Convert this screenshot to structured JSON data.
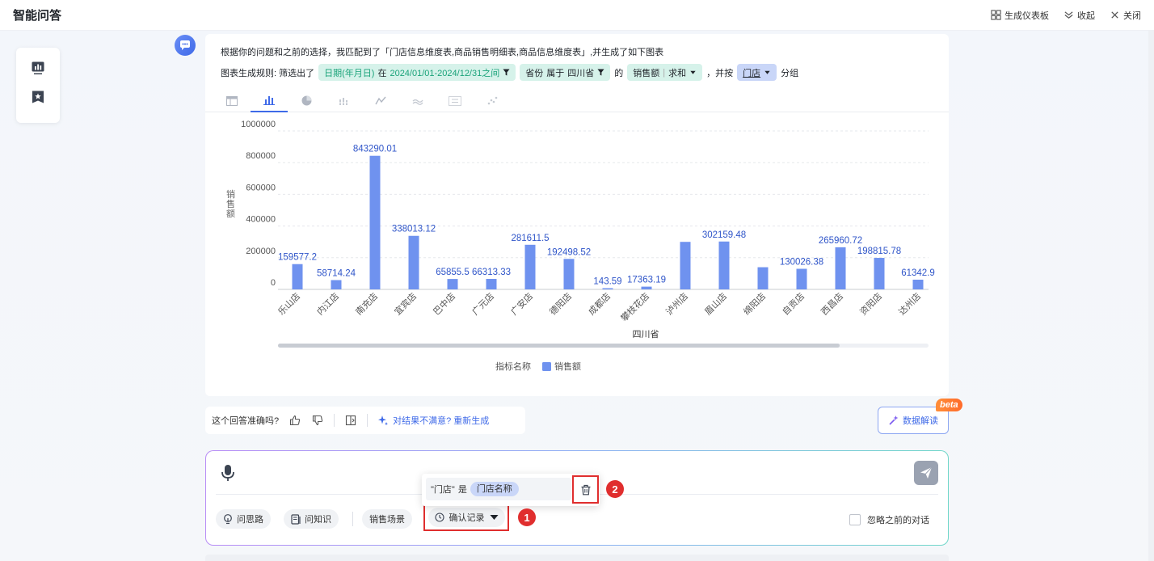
{
  "header": {
    "title": "智能问答",
    "actions": [
      {
        "label": "生成仪表板",
        "icon": "dashboard-grid-icon"
      },
      {
        "label": "收起",
        "icon": "collapse-chevron-icon"
      },
      {
        "label": "关闭",
        "icon": "close-icon"
      }
    ]
  },
  "side_tools": [
    {
      "icon": "chart-icon"
    },
    {
      "icon": "star-bookmark-icon"
    }
  ],
  "answer": {
    "text": "根据你的问题和之前的选择，我匹配到了「门店信息维度表,商品销售明细表,商品信息维度表」,并生成了如下图表",
    "rule_prefix": "图表生成规则: 筛选出了",
    "filter_date_field": "日期(年月日)",
    "filter_date_op": "在",
    "filter_date_value": "2024/01/01-2024/12/31之间",
    "filter_province_field": "省份",
    "filter_province_op": "属于",
    "filter_province_value": "四川省",
    "connector_of": "的",
    "measure_field": "销售额",
    "measure_agg": "求和",
    "connector_group": "，并按",
    "group_field": "门店",
    "group_suffix": "分组"
  },
  "chart_tabs": [
    {
      "icon": "table-icon",
      "active": false
    },
    {
      "icon": "bar-chart-icon",
      "active": true
    },
    {
      "icon": "pie-chart-icon",
      "active": false
    },
    {
      "icon": "stacked-bar-icon",
      "active": false
    },
    {
      "icon": "line-chart-icon",
      "active": false
    },
    {
      "icon": "area-chart-icon",
      "active": false
    },
    {
      "icon": "kpi-number-icon",
      "active": false
    },
    {
      "icon": "scatter-chart-icon",
      "active": false
    }
  ],
  "chart_data": {
    "type": "bar",
    "categories": [
      "乐山店",
      "内江店",
      "南充店",
      "宜宾店",
      "巴中店",
      "广元店",
      "广安店",
      "德阳店",
      "成都店",
      "攀枝花店",
      "泸州店",
      "眉山店",
      "绵阳店",
      "自贡店",
      "西昌店",
      "资阳店",
      "达州店"
    ],
    "values": [
      159577.2,
      58714.24,
      843290.01,
      338013.12,
      65855.5,
      66313.33,
      281611.5,
      192498.52,
      143.59,
      17363.19,
      300000,
      302159.48,
      140000,
      130026.38,
      265960.72,
      198815.78,
      61342.9
    ],
    "value_labels": [
      "159577.2",
      "58714.24",
      "843290.01",
      "338013.12",
      "65855.5",
      "66313.33",
      "281611.5",
      "192498.52",
      "143.59",
      "17363.19",
      "",
      "302159.48",
      "",
      "130026.38",
      "265960.72",
      "198815.78",
      "61342.9"
    ],
    "y_ticks": [
      "0",
      "200000",
      "400000",
      "600000",
      "800000",
      "1000000"
    ],
    "ylim": [
      0,
      1000000
    ],
    "ylabel": "销售额",
    "xlabel": "四川省",
    "legend_title": "指标名称",
    "series_name": "销售额",
    "bar_color": "#6f92ef",
    "grid": true,
    "legend_position": "bottom"
  },
  "feedback": {
    "question": "这个回答准确吗?",
    "regenerate": "对结果不满意? 重新生成"
  },
  "data_interpret": {
    "label": "数据解读",
    "badge": "beta"
  },
  "input": {
    "buttons": [
      "问思路",
      "问知识",
      "销售场景"
    ],
    "confirm_record": "确认记录",
    "ignore_previous": "忽略之前的对话"
  },
  "record_popup": {
    "field": "\"门店\"",
    "is": "是",
    "value": "门店名称"
  },
  "steps": [
    "1",
    "2"
  ],
  "colors": {
    "accent": "#3f6ae8",
    "highlight": "#e02e2e",
    "filter_green": "#d6f2ea",
    "filter_blue": "#c9d6f8"
  }
}
